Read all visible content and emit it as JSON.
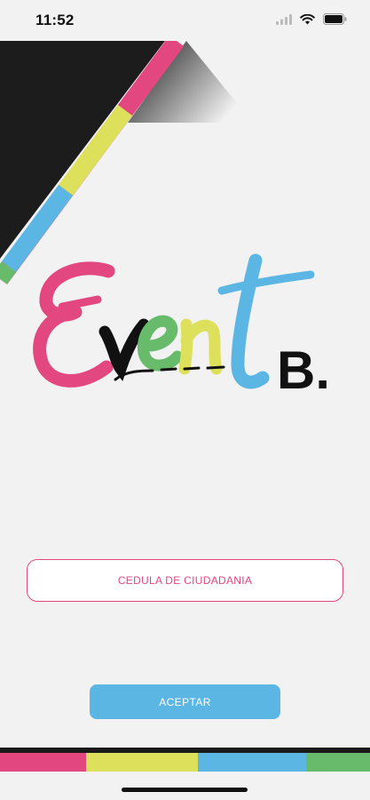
{
  "status_bar": {
    "time": "11:52",
    "icons": [
      "cellular-signal-icon",
      "wifi-icon",
      "battery-icon"
    ]
  },
  "logo": {
    "word": "Event",
    "suffix": "B.",
    "letter_colors": [
      "#e2477f",
      "#111111",
      "#69bb6c",
      "#dde05a",
      "#5cb6e4"
    ]
  },
  "id_field": {
    "placeholder": "CEDULA DE CIUDADANIA",
    "value": ""
  },
  "accept_button": {
    "label": "ACEPTAR"
  },
  "colors": {
    "pink": "#e2477f",
    "yellow": "#dde05a",
    "blue": "#5cb6e4",
    "green": "#69bb6c",
    "black": "#1a1a1a",
    "background": "#f2f2f2"
  }
}
